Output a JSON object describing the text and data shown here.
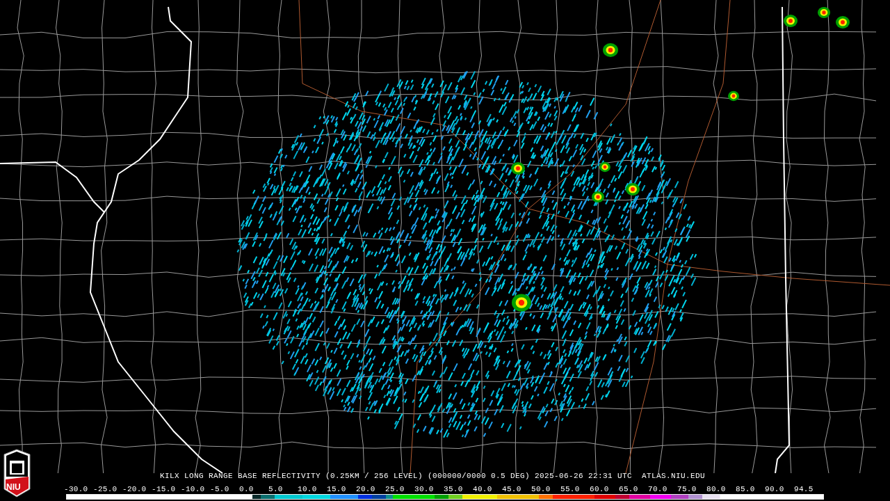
{
  "caption": "KILX LONG RANGE BASE REFLECTIVITY (0.25KM / 256 LEVEL) (000000/0000 0.5 DEG) 2025-06-26 22:31 UTC  ATLAS.NIU.EDU",
  "logo": {
    "text": "NIU"
  },
  "scale_labels": [
    "-30.0",
    "-25.0",
    "-20.0",
    "-15.0",
    "-10.0",
    "-5.0",
    "0.0",
    "5.0",
    "10.0",
    "15.0",
    "20.0",
    "25.0",
    "30.0",
    "35.0",
    "40.0",
    "45.0",
    "50.0",
    "55.0",
    "60.0",
    "65.0",
    "70.0",
    "75.0",
    "80.0",
    "85.0",
    "90.0",
    "94.5"
  ]
}
